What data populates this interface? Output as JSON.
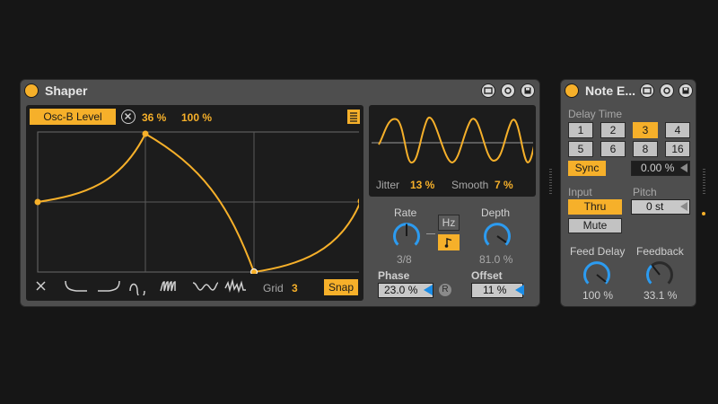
{
  "shaper": {
    "title": "Shaper",
    "target_label": "Osc-B Level",
    "target_amount": "36 %",
    "target_scale": "100 %",
    "grid_label": "Grid",
    "grid_value": "3",
    "snap_label": "Snap",
    "jitter_label": "Jitter",
    "jitter_value": "13 %",
    "smooth_label": "Smooth",
    "smooth_value": "7 %",
    "rate_label": "Rate",
    "rate_value": "3/8",
    "hz_label": "Hz",
    "depth_label": "Depth",
    "depth_value": "81.0 %",
    "phase_label": "Phase",
    "phase_value": "23.0 %",
    "r_label": "R",
    "offset_label": "Offset",
    "offset_value": "11 %",
    "accent_color": "#f6b02a",
    "knob_color": "#2c9bf0"
  },
  "note_echo": {
    "title": "Note E...",
    "delay_time_label": "Delay Time",
    "delay_buttons": [
      "1",
      "2",
      "3",
      "4",
      "5",
      "6",
      "8",
      "16"
    ],
    "delay_selected": "3",
    "sync_label": "Sync",
    "delay_value": "0.00 %",
    "input_label": "Input",
    "thru_label": "Thru",
    "mute_label": "Mute",
    "pitch_label": "Pitch",
    "pitch_value": "0 st",
    "feed_delay_label": "Feed Delay",
    "feed_delay_value": "100 %",
    "feedback_label": "Feedback",
    "feedback_value": "33.1 %"
  }
}
